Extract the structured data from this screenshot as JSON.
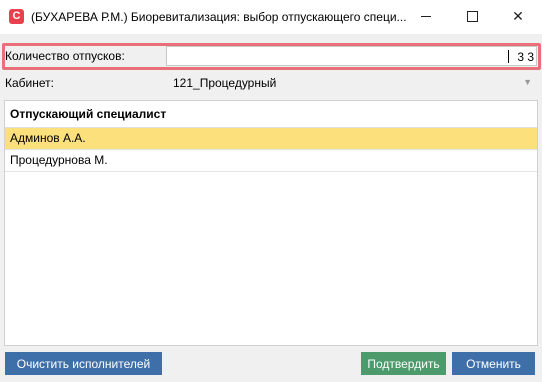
{
  "window": {
    "app_icon_glyph": "C",
    "title": "(БУХАРЕВА Р.М.) Биоревитализация: выбор отпускающего специ...",
    "minimize_glyph": "",
    "close_glyph": "✕"
  },
  "form": {
    "quantity_label": "Количество отпусков:",
    "quantity_value": "3",
    "quantity_value_trailing": "3",
    "cabinet_label": "Кабинет:",
    "cabinet_value": "121_Процедурный"
  },
  "grid": {
    "header": "Отпускающий специалист",
    "rows": [
      "Админов А.А.",
      "Процедурнова М."
    ],
    "selected_index": 0
  },
  "buttons": {
    "clear": "Очистить исполнителей",
    "confirm": "Подтвердить",
    "cancel": "Отменить"
  },
  "colors": {
    "highlight": "#e8707a",
    "selected_row": "#fbe07c",
    "primary_button": "#3f6fa8",
    "confirm_button": "#4d9a6c"
  }
}
